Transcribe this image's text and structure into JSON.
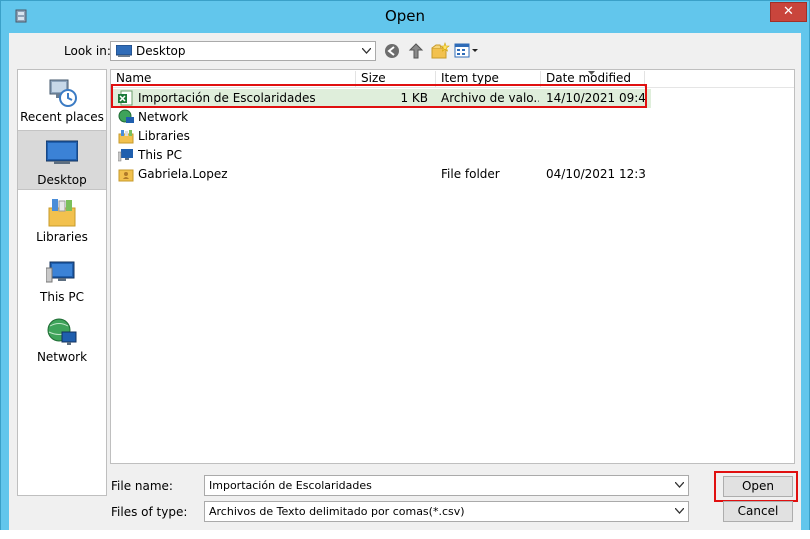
{
  "window": {
    "title": "Open",
    "close_glyph": "✕"
  },
  "toolbar": {
    "look_in_label": "Look in:",
    "look_in_value": "Desktop",
    "icons": [
      "back-icon",
      "up-folder-icon",
      "new-folder-icon",
      "view-menu-icon"
    ]
  },
  "places": [
    {
      "label": "Recent places",
      "icon": "recent-places-icon"
    },
    {
      "label": "Desktop",
      "icon": "desktop-icon",
      "selected": true
    },
    {
      "label": "Libraries",
      "icon": "libraries-icon"
    },
    {
      "label": "This PC",
      "icon": "this-pc-icon"
    },
    {
      "label": "Network",
      "icon": "network-icon"
    }
  ],
  "columns": {
    "name": "Name",
    "size": "Size",
    "type": "Item type",
    "date": "Date modified"
  },
  "files": [
    {
      "name": "Importación de Escolaridades",
      "size": "1 KB",
      "type": "Archivo de valo...",
      "date": "14/10/2021 09:4...",
      "icon": "excel-csv-icon",
      "selected": true
    },
    {
      "name": "Network",
      "size": "",
      "type": "",
      "date": "",
      "icon": "network-icon"
    },
    {
      "name": "Libraries",
      "size": "",
      "type": "",
      "date": "",
      "icon": "libraries-icon"
    },
    {
      "name": "This PC",
      "size": "",
      "type": "",
      "date": "",
      "icon": "this-pc-icon"
    },
    {
      "name": "Gabriela.Lopez",
      "size": "",
      "type": "File folder",
      "date": "04/10/2021 12:3...",
      "icon": "user-folder-icon"
    }
  ],
  "footer": {
    "file_name_label": "File name:",
    "file_name_value": "Importación de Escolaridades",
    "files_of_type_label": "Files of type:",
    "files_of_type_value": "Archivos de Texto delimitado por comas(*.csv)",
    "open_label": "Open",
    "cancel_label": "Cancel"
  },
  "colors": {
    "titlebar": "#62c6ec",
    "highlight": "#e01010",
    "selection": "#dfeedb"
  }
}
